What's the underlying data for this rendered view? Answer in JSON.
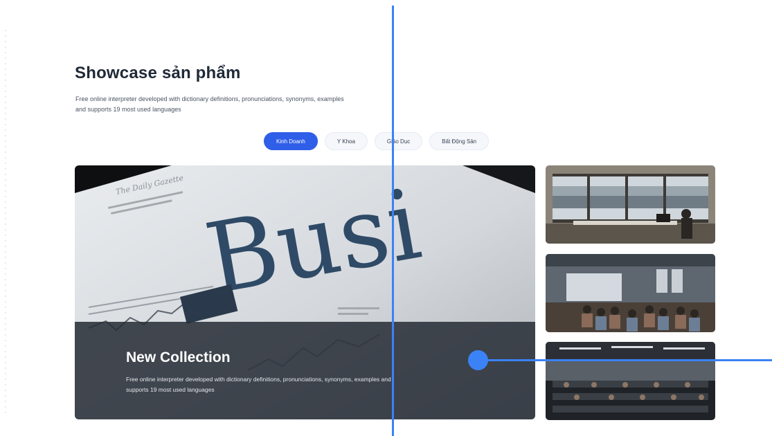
{
  "section": {
    "title": "Showcase sản phẩm",
    "description": "Free online interpreter developed with dictionary definitions, pronunciations, synonyms, examples and supports 19 most used languages"
  },
  "tabs": [
    {
      "label": "Kinh Doanh",
      "active": true
    },
    {
      "label": "Y Khoa",
      "active": false
    },
    {
      "label": "Giáo Dục",
      "active": false
    },
    {
      "label": "Bất Động Sản",
      "active": false
    }
  ],
  "hero": {
    "title": "New Collection",
    "description": "Free online interpreter developed with dictionary definitions, pronunciations, synonyms, examples and supports 19 most used languages",
    "photo_text": "Busi"
  },
  "thumbnails": [
    {
      "subject": "office-window-photo"
    },
    {
      "subject": "meeting-room-photo"
    },
    {
      "subject": "open-office-photo"
    }
  ],
  "colors": {
    "accent": "#2f5ee8",
    "guide": "#3b82f6",
    "overlay": "#262c36"
  }
}
